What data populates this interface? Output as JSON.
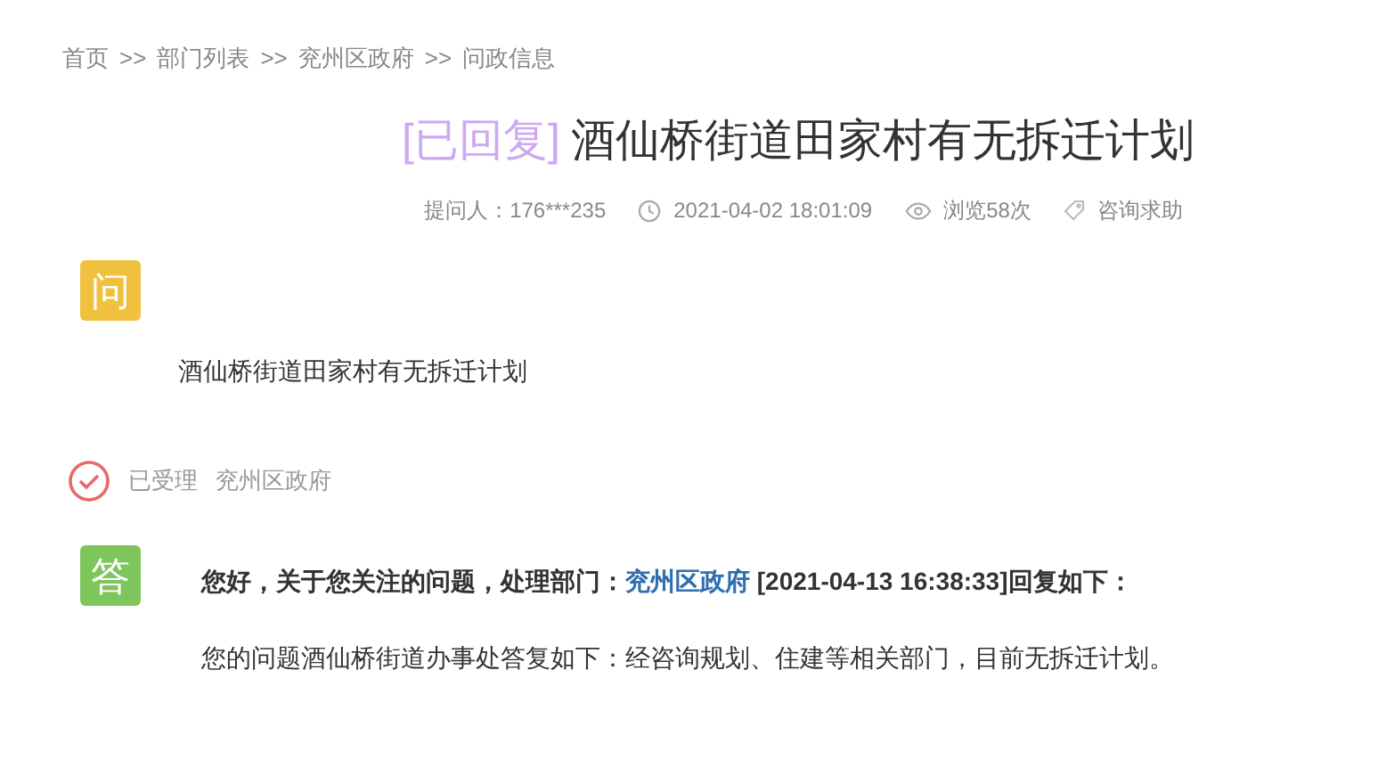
{
  "breadcrumb": {
    "separator": ">>",
    "items": [
      "首页",
      "部门列表",
      "兖州区政府",
      "问政信息"
    ]
  },
  "title": {
    "status": "[已回复]",
    "text": "酒仙桥街道田家村有无拆迁计划"
  },
  "meta": {
    "asker": "提问人：176***235",
    "time": "2021-04-02 18:01:09",
    "views": "浏览58次",
    "category": "咨询求助"
  },
  "question": {
    "badge": "问",
    "text": "酒仙桥街道田家村有无拆迁计划"
  },
  "progress": {
    "state": "已受理",
    "department": "兖州区政府"
  },
  "answer": {
    "badge": "答",
    "intro": "您好，关于您关注的问题，处理部门：",
    "department": "兖州区政府",
    "outro": " [2021-04-13 16:38:33]回复如下：",
    "body": "您的问题酒仙桥街道办事处答复如下：经咨询规划、住建等相关部门，目前无拆迁计划。"
  }
}
